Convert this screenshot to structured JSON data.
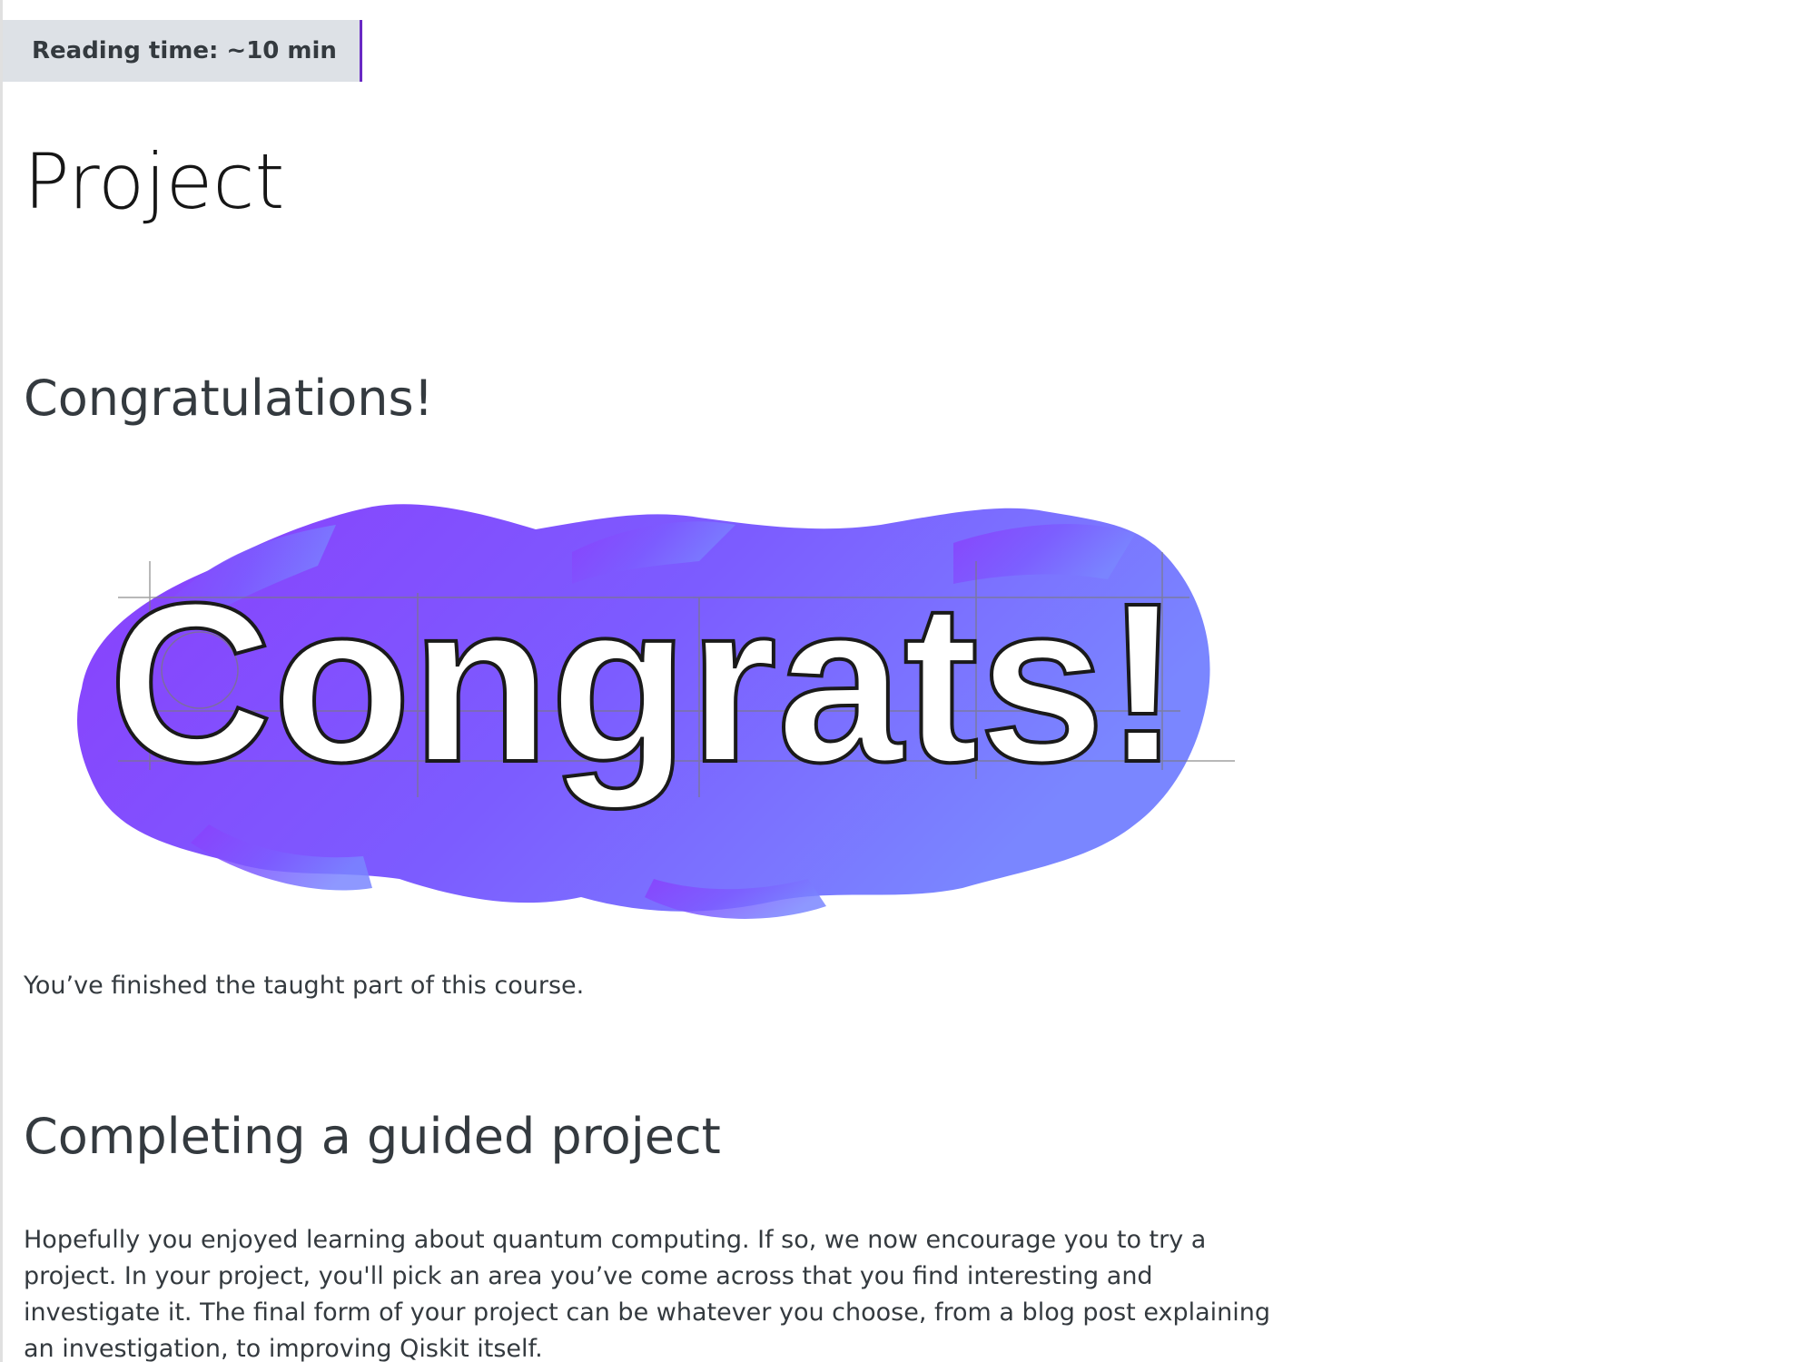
{
  "reading_time": "Reading time: ~10 min",
  "page_title": "Project",
  "sections": {
    "congratulations_heading": "Congratulations!",
    "image_text": "Congrats!",
    "finished_text": "You’ve finished the taught part of this course.",
    "guided_heading": "Completing a guided project",
    "guided_text": "Hopefully you enjoyed learning about quantum computing. If so, we now encourage you to try a project. In your project, you'll pick an area you’ve come across that you find interesting and investigate it. The final form of your project can be whatever you choose, from a blog post explaining an investigation, to improving Qiskit itself."
  },
  "colors": {
    "accent": "#6929c4",
    "badge_bg": "#dde1e6",
    "gradient_start": "#8a3ffc",
    "gradient_end": "#7a86ff",
    "text": "#343a3f",
    "title": "#161616"
  },
  "icons": {
    "image": "congrats-illustration"
  }
}
